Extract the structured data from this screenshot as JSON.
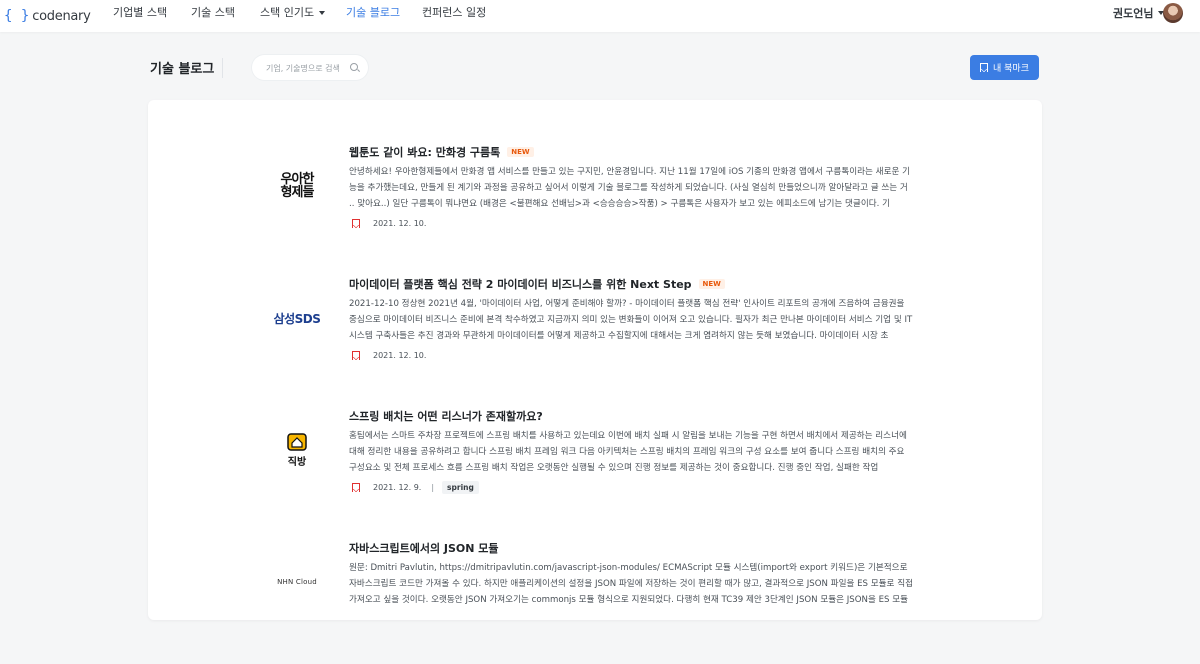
{
  "nav": {
    "logo_mark": "{ }",
    "logo_text": "codenary",
    "items": [
      {
        "label": "기업별 스택"
      },
      {
        "label": "기술 스택"
      },
      {
        "label": "스택 인기도"
      },
      {
        "label": "기술 블로그"
      },
      {
        "label": "컨퍼런스 일정"
      }
    ],
    "user_name": "권도언님",
    "accent_color": "#3b7de3"
  },
  "header": {
    "title": "기술 블로그",
    "search_placeholder": "기업, 기술명으로 검색",
    "bookmark_button": "내 북마크"
  },
  "posts": [
    {
      "company": "우아한형제들",
      "logo_lines": [
        "우아한",
        "형제들"
      ],
      "title": "웹툰도 같이 봐요: 만화경 구름톡",
      "badge": "NEW",
      "body": "안녕하세요! 우아한형제들에서 만화경 앱 서비스를 만들고 있는 구지민, 안윤경입니다. 지난 11월 17일에 iOS 기종의 만화경 앱에서 구름톡이라는 새로운 기능을 추가했는데요, 만들게 된 계기와 과정을 공유하고 싶어서 이렇게 기술 블로그를 작성하게 되었습니다. (사실 열심히 만들었으니까 알아달라고 글 쓰는 거 .. 맞아요..) 일단 구름톡이 뭐냐면요 (배경은 <불편해요 선배님>과 <승승승승>작품) > 구름톡은 사용자가 보고 있는 에피소드에 남기는 댓글이다. 기",
      "date": "2021. 12. 10.",
      "tag": ""
    },
    {
      "company": "삼성SDS",
      "logo_lines": [
        "삼성SDS"
      ],
      "title": "마이데이터 플랫폼 핵심 전략 2 마이데이터 비즈니스를 위한 Next Step",
      "badge": "NEW",
      "body": "2021-12-10 정상현 2021년 4월, '마이데이터 사업, 어떻게 준비해야 할까? - 마이데이터 플랫폼 핵심 전략' 인사이트 리포트의 공개에 즈음하여 금융권을 중심으로 마이데이터 비즈니스 준비에 본격 착수하였고 지금까지 의미 있는 변화들이 이어져 오고 있습니다. 필자가 최근 만나본 마이데이터 서비스 기업 및 IT 시스템 구축사들은 추진 경과와 무관하게 마이데이터를 어떻게 제공하고 수집할지에 대해서는 크게 염려하지 않는 듯해 보였습니다. 마이데이터 시장 초",
      "date": "2021. 12. 10.",
      "tag": ""
    },
    {
      "company": "직방",
      "logo_lines": [
        "직방"
      ],
      "title": "스프링 배치는 어떤 리스너가 존재할까요?",
      "badge": "",
      "body": "홈팀에서는 스마트 주차장 프로젝트에 스프링 배치를 사용하고 있는데요 이번에 배치 실패 시 알림을 보내는 기능을 구현 하면서 배치에서 제공하는 리스너에 대해 정리한 내용을 공유하려고 합니다 스프링 배치 프레임 워크 다음 아키텍처는 스프링 배치의 프레임 워크의 구성 요소를 보여 줍니다 스프링 배치의 주요 구성요소 및 전체 프로세스 흐름 스프링 배치 작업은 오랫동안 실행될 수 있으며 진행 정보를 제공하는 것이 중요합니다. 진행 중인 작업, 실패한 작업",
      "date": "2021. 12. 9.",
      "tag": "spring"
    },
    {
      "company": "NHN Cloud",
      "logo_lines": [
        "NHN Cloud"
      ],
      "title": "자바스크립트에서의 JSON 모듈",
      "badge": "",
      "body": "원문: Dmitri Pavlutin, https://dmitripavlutin.com/javascript-json-modules/ ECMAScript 모듈 시스템(import와 export 키워드)은 기본적으로 자바스크립트 코드만 가져올 수 있다. 하지만 애플리케이션의 설정을 JSON 파일에 저장하는 것이 편리할 때가 많고, 결과적으로 JSON 파일을 ES 모듈로 직접 가져오고 싶을 것이다. 오랫동안 JSON 가져오기는 commonjs 모듈 형식으로 지원되었다. 다행히 현재 TC39 제안 3단계인 JSON 모듈은 JSON을 ES 모듈",
      "date": "",
      "tag": ""
    }
  ]
}
